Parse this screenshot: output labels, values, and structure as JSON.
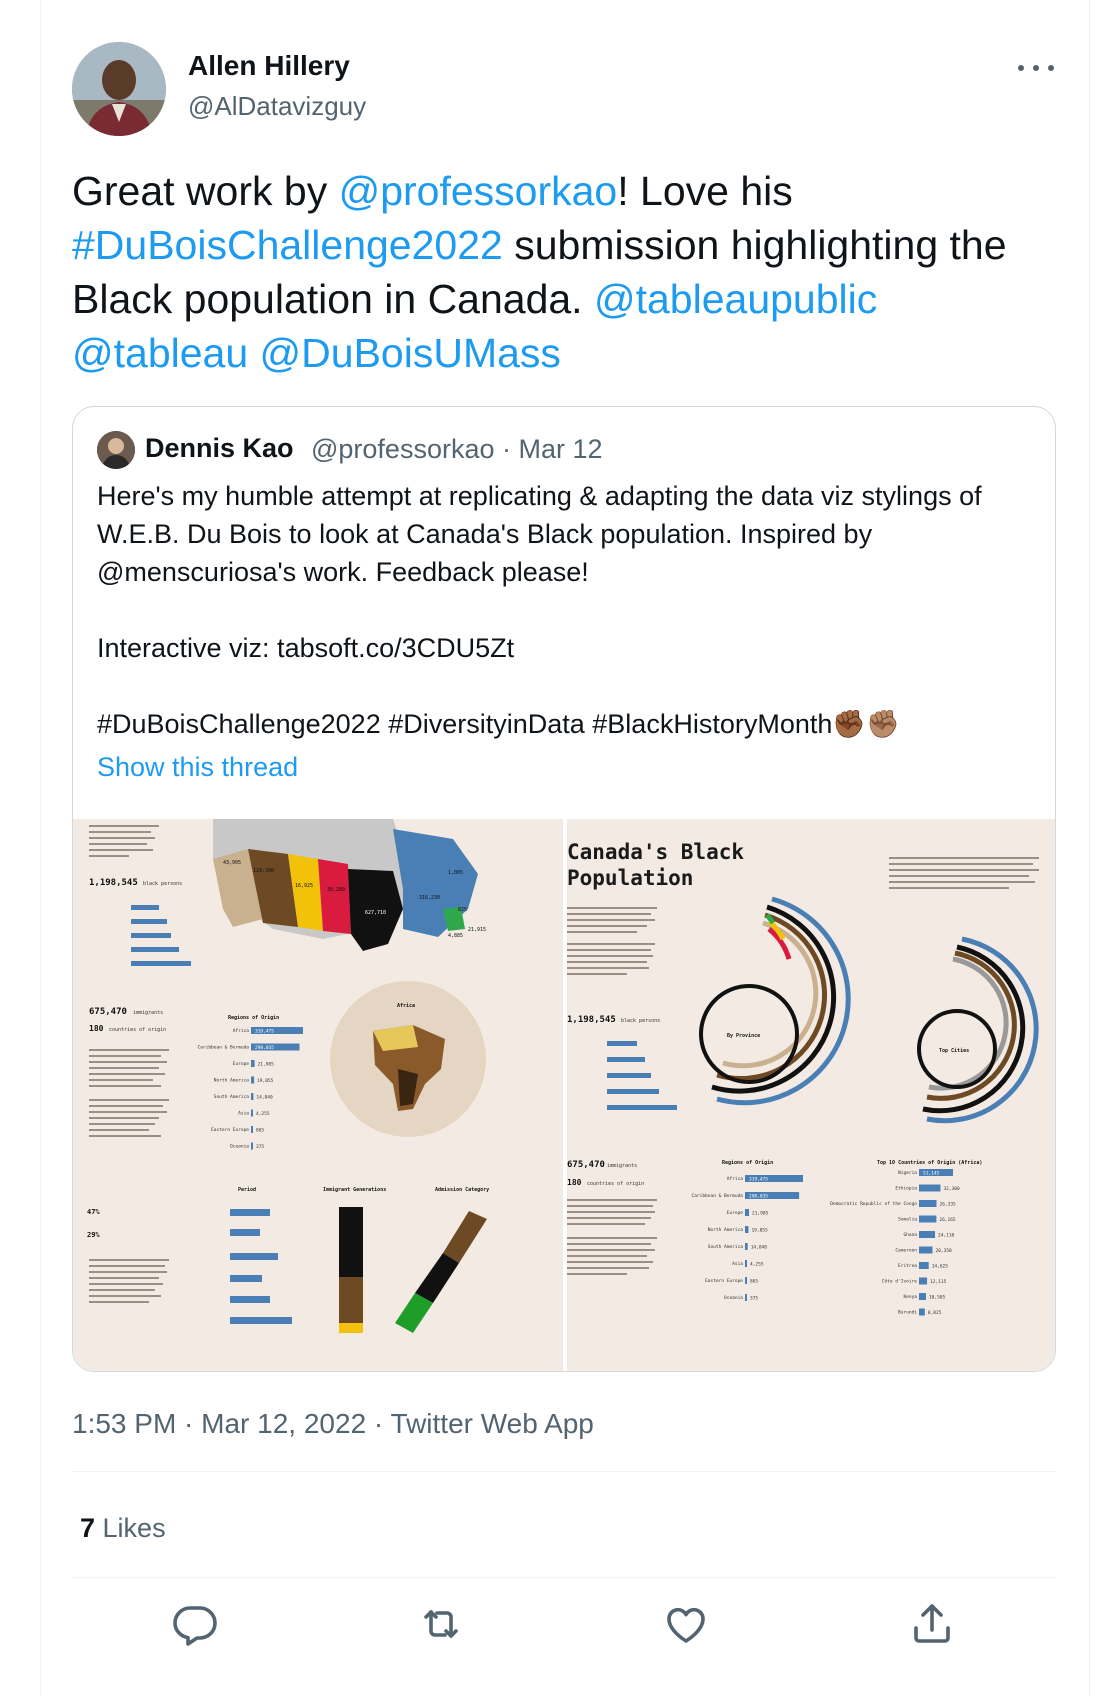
{
  "tweet": {
    "author": {
      "name": "Allen Hillery",
      "handle": "@AlDatavizguy"
    },
    "more_icon": "more-horizontal-icon",
    "text": {
      "t1": "Great work by ",
      "mention1": "@professorkao",
      "t2": "! Love his ",
      "hashtag": "#DuBoisChallenge2022",
      "t3": " submission highlighting the Black population in Canada. ",
      "mention2": "@tableaupublic",
      "mention3": "@tableau",
      "mention4": "@DuBoisUMass"
    },
    "quoted": {
      "author_name": "Dennis Kao",
      "handle_date": "@professorkao · Mar 12",
      "text": "Here's my humble attempt at replicating & adapting the data viz stylings of W.E.B. Du Bois to look at Canada's Black population. Inspired by @menscuriosa's work. Feedback please!\n\nInteractive viz: tabsoft.co/3CDU5Zt\n\n#DuBoisChallenge2022 #DiversityinData #BlackHistoryMonth",
      "emoji": "✊🏾✊🏽",
      "show_thread": "Show this thread",
      "media": {
        "left": {
          "total": "1,198,545",
          "total_label": "black persons",
          "immigrants": "675,470",
          "immigrants_label": "immigrants",
          "countries": "180",
          "countries_label": "countries of origin",
          "regions_title": "Regions of Origin",
          "africa_title": "Africa",
          "period_title": "Period",
          "generations_title": "Immigrant Generations",
          "admission_title": "Admission Category",
          "pct_after": "47%",
          "pct_refugees": "29%",
          "map_values": [
            "43,905",
            "129,390",
            "16,925",
            "39,280",
            "627,710",
            "316,230",
            "825",
            "4,885",
            "21,915",
            "1,005"
          ],
          "region_bars": [
            {
              "label": "Africa",
              "value": "319,475"
            },
            {
              "label": "Caribbean & Bermuda",
              "value": "298,035"
            },
            {
              "label": "Europe",
              "value": "21,985"
            },
            {
              "label": "North America",
              "value": "19,055"
            },
            {
              "label": "South America",
              "value": "14,840"
            },
            {
              "label": "Asia",
              "value": "4,255"
            },
            {
              "label": "Eastern Europe",
              "value": "865"
            },
            {
              "label": "Oceania",
              "value": "375"
            }
          ]
        },
        "right": {
          "title_line1": "Canada's Black",
          "title_line2": "Population",
          "total": "1,198,545",
          "total_label": "black persons",
          "immigrants": "675,470",
          "immigrants_label": "immigrants",
          "countries": "180",
          "countries_label": "countries of origin",
          "by_province": "By Province",
          "top_cities": "Top Cities",
          "regions_title": "Regions of Origin",
          "top_countries_title": "Top 10 Countries of Origin (Africa)",
          "countries_bars": [
            {
              "label": "Nigeria",
              "value": "51,145"
            },
            {
              "label": "Ethiopia",
              "value": "32,300"
            },
            {
              "label": "Democratic Republic of the Congo",
              "value": "26,335"
            },
            {
              "label": "Somalia",
              "value": "26,165"
            },
            {
              "label": "Ghana",
              "value": "24,110"
            },
            {
              "label": "Cameroon",
              "value": "20,350"
            },
            {
              "label": "Eritrea",
              "value": "14,625"
            },
            {
              "label": "Côte d'Ivoire",
              "value": "12,115"
            },
            {
              "label": "Kenya",
              "value": "10,505"
            },
            {
              "label": "Burundi",
              "value": "8,825"
            }
          ]
        }
      }
    },
    "timestamp": "1:53 PM · Mar 12, 2022 · Twitter Web App",
    "likes": {
      "count": "7",
      "label": " Likes"
    },
    "actions": [
      "reply-icon",
      "retweet-icon",
      "like-icon",
      "share-icon"
    ]
  }
}
